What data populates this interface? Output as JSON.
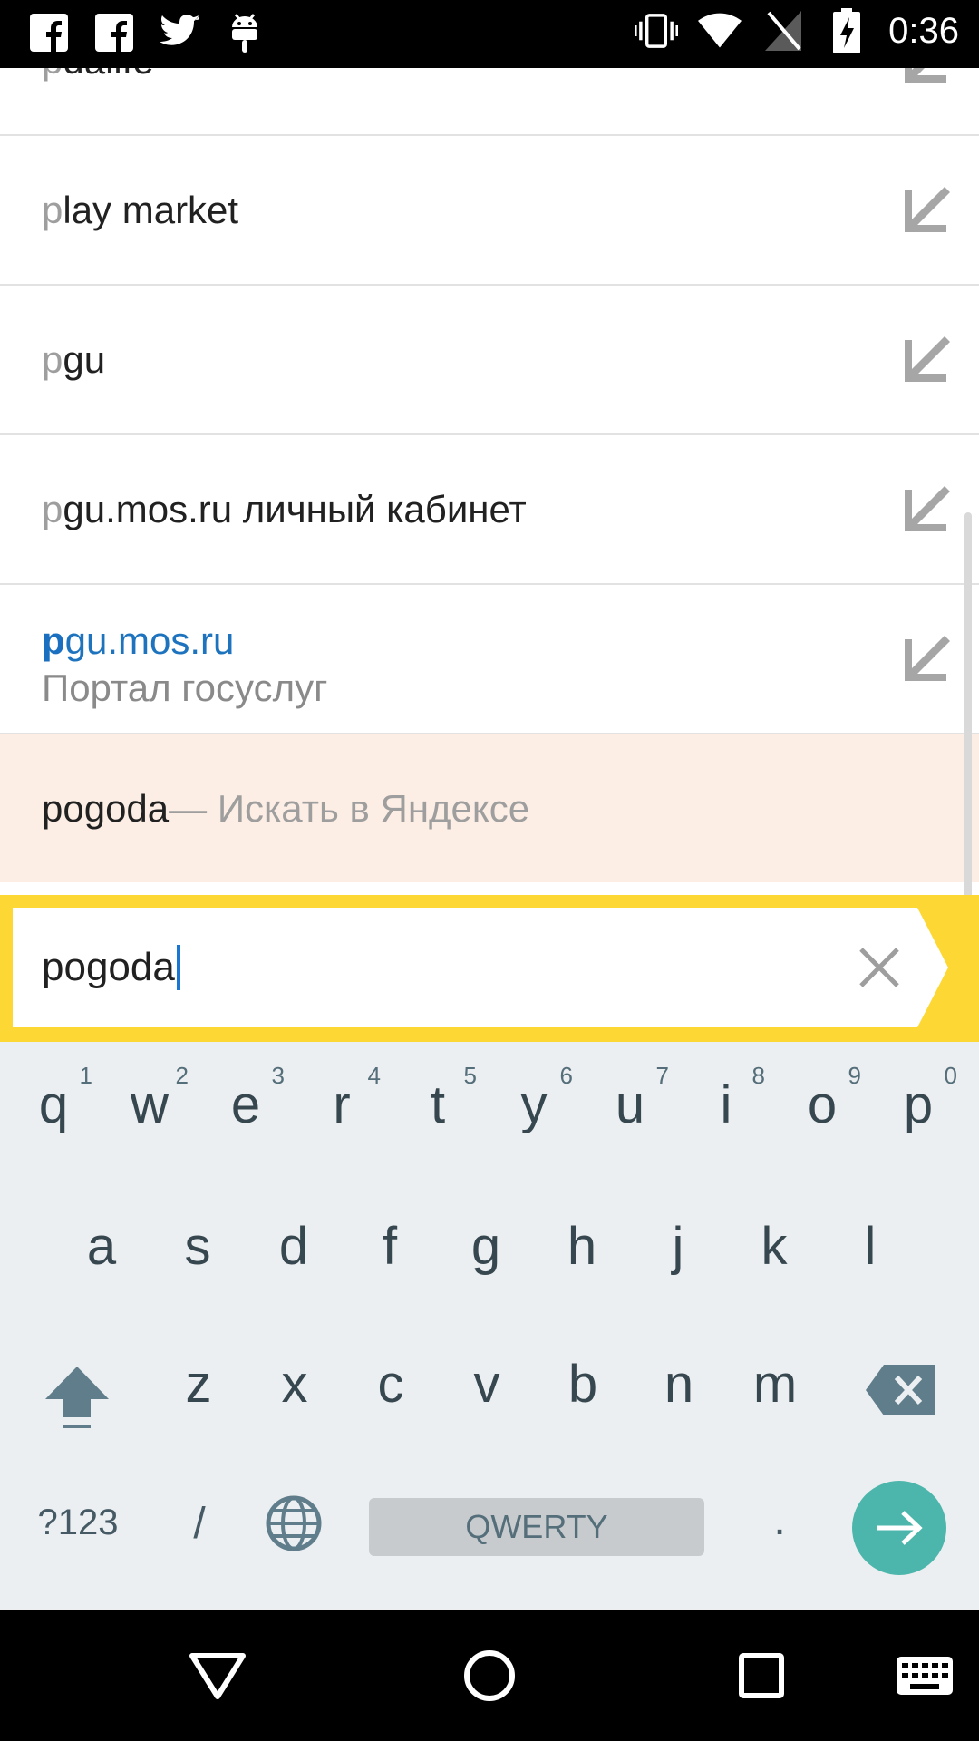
{
  "status_bar": {
    "time": "0:36",
    "left_icons": [
      "facebook-icon",
      "facebook-icon",
      "twitter-icon",
      "android-icon"
    ],
    "right_icons": [
      "vibrate-icon",
      "wifi-icon",
      "no-sim-icon",
      "battery-charging-icon"
    ]
  },
  "suggestions": {
    "items": [
      {
        "prefix": "p",
        "rest": "dalife"
      },
      {
        "prefix": "p",
        "rest": "lay market"
      },
      {
        "prefix": "p",
        "rest": "gu"
      },
      {
        "prefix": "p",
        "rest": "gu.mos.ru личный кабинет"
      },
      {
        "prefix": "p",
        "rest": "gu.mos.ru",
        "subtitle": "Портал госуслуг"
      }
    ],
    "search_suggestion": {
      "query": "pogoda",
      "hint": " — Искать в Яндексе"
    }
  },
  "search": {
    "value": "pogoda"
  },
  "keyboard": {
    "row1": [
      {
        "l": "q",
        "n": "1"
      },
      {
        "l": "w",
        "n": "2"
      },
      {
        "l": "e",
        "n": "3"
      },
      {
        "l": "r",
        "n": "4"
      },
      {
        "l": "t",
        "n": "5"
      },
      {
        "l": "y",
        "n": "6"
      },
      {
        "l": "u",
        "n": "7"
      },
      {
        "l": "i",
        "n": "8"
      },
      {
        "l": "o",
        "n": "9"
      },
      {
        "l": "p",
        "n": "0"
      }
    ],
    "row2": [
      "a",
      "s",
      "d",
      "f",
      "g",
      "h",
      "j",
      "k",
      "l"
    ],
    "row3": [
      "z",
      "x",
      "c",
      "v",
      "b",
      "n",
      "m"
    ],
    "symbols_label": "?123",
    "slash_label": "/",
    "space_label": "QWERTY",
    "period_label": "."
  },
  "colors": {
    "accent_yellow": "#fdd835",
    "link_blue": "#1e73be",
    "enter_teal": "#4db6ac",
    "search_row_bg": "#fdeee5"
  }
}
